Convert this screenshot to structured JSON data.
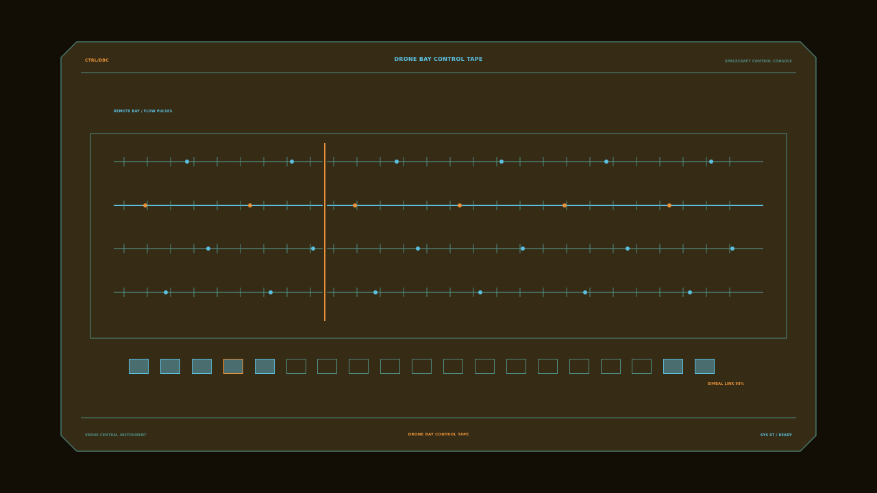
{
  "header": {
    "left_code": "CTRL/DBC",
    "title": "DRONE BAY CONTROL TAPE",
    "right_label": "SPACECRAFT CONTROL CONSOLE"
  },
  "panel": {
    "label": "REMOTE BAY / FLOW PULSES"
  },
  "status": {
    "gimbal": "GIMBAL LINK 98%"
  },
  "footer": {
    "left": "VENUE CENTRAL INSTRUMENT",
    "title": "DRONE BAY CONTROL TAPE",
    "right": "SYS 97 / READY"
  },
  "colors": {
    "background": "#120e06",
    "panel": "#362b15",
    "frame": "#4f8d82",
    "accent_cyan": "#5bc0e0",
    "accent_orange": "#e8923a"
  },
  "tape": {
    "tracks": [
      {
        "highlighted": false,
        "pulse_color": "cyan"
      },
      {
        "highlighted": true,
        "pulse_color": "orange"
      },
      {
        "highlighted": false,
        "pulse_color": "cyan"
      },
      {
        "highlighted": false,
        "pulse_color": "cyan"
      }
    ]
  },
  "blocks": [
    "on",
    "on",
    "on",
    "selected",
    "on",
    "off",
    "off",
    "off",
    "off",
    "off",
    "off",
    "off",
    "off",
    "off",
    "off",
    "off",
    "off",
    "on",
    "on"
  ]
}
